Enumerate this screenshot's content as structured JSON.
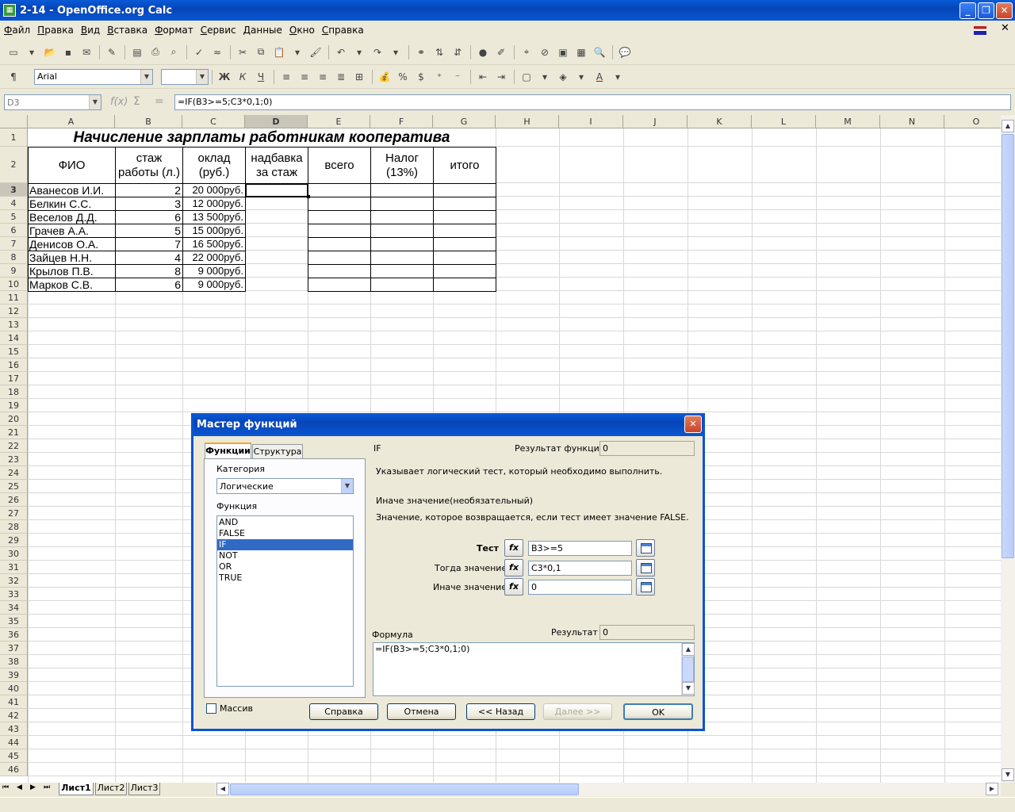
{
  "window": {
    "title": "2-14 - OpenOffice.org Calc"
  },
  "menu": [
    "Файл",
    "Правка",
    "Вид",
    "Вставка",
    "Формат",
    "Сервис",
    "Данные",
    "Окно",
    "Справка"
  ],
  "format_bar": {
    "font_name": "Arial",
    "font_size": ""
  },
  "formula_bar": {
    "name_box": "D3",
    "sum_symbol": "Σ",
    "equals_symbol": "=",
    "formula": "=IF(B3>=5;C3*0,1;0)"
  },
  "columns": [
    "A",
    "B",
    "C",
    "D",
    "E",
    "F",
    "G",
    "H",
    "I",
    "J",
    "K",
    "L",
    "M",
    "N",
    "O"
  ],
  "rows": [
    "1",
    "2",
    "3",
    "4",
    "5",
    "6",
    "7",
    "8",
    "9",
    "10",
    "11",
    "12",
    "13",
    "14",
    "15",
    "16",
    "17",
    "18",
    "19",
    "20",
    "21",
    "22",
    "23",
    "24",
    "25",
    "26",
    "27",
    "28",
    "29",
    "30",
    "31",
    "32",
    "33",
    "34",
    "35",
    "36",
    "37",
    "38",
    "39",
    "40",
    "41",
    "42",
    "43",
    "44",
    "45",
    "46"
  ],
  "sheet": {
    "title": "Начисление зарплаты работникам кооператива",
    "headers": [
      "ФИО",
      "стаж работы (л.)",
      "оклад (руб.)",
      "надбавка за стаж",
      "всего",
      "Налог (13%)",
      "итого"
    ],
    "header_lines": [
      [
        "ФИО"
      ],
      [
        "стаж",
        "работы (л.)"
      ],
      [
        "оклад",
        "(руб.)"
      ],
      [
        "надбавка",
        "за стаж"
      ],
      [
        "всего"
      ],
      [
        "Налог",
        "(13%)"
      ],
      [
        "итого"
      ]
    ],
    "data": [
      {
        "name": "Аванесов И.И.",
        "years": "2",
        "salary": "20 000руб."
      },
      {
        "name": "Белкин С.С.",
        "years": "3",
        "salary": "12 000руб."
      },
      {
        "name": "Веселов Д.Д.",
        "years": "6",
        "salary": "13 500руб."
      },
      {
        "name": "Грачев А.А.",
        "years": "5",
        "salary": "15 000руб."
      },
      {
        "name": "Денисов О.А.",
        "years": "7",
        "salary": "16 500руб."
      },
      {
        "name": "Зайцев Н.Н.",
        "years": "4",
        "salary": "22 000руб."
      },
      {
        "name": "Крылов П.В.",
        "years": "8",
        "salary": "9 000руб."
      },
      {
        "name": "Марков С.В.",
        "years": "6",
        "salary": "9 000руб."
      }
    ]
  },
  "sheet_tabs": [
    "Лист1",
    "Лист2",
    "Лист3"
  ],
  "dialog": {
    "title": "Мастер функций",
    "tabs": [
      "Функции",
      "Структура"
    ],
    "category_label": "Категория",
    "category_value": "Логические",
    "function_label": "Функция",
    "functions": [
      "AND",
      "FALSE",
      "IF",
      "NOT",
      "OR",
      "TRUE"
    ],
    "selected_function": "IF",
    "func_name": "IF",
    "func_result_label": "Результат функции",
    "func_result_value": "0",
    "description": "Указывает логический тест, который необходимо выполнить.",
    "arg_title": "Иначе значение(необязательный)",
    "arg_description": "Значение, которое возвращается, если тест имеет значение FALSE.",
    "args": [
      {
        "label": "Тест",
        "value": "B3>=5"
      },
      {
        "label": "Тогда значение",
        "value": "C3*0,1"
      },
      {
        "label": "Иначе значение",
        "value": "0"
      }
    ],
    "fx_label": "fx",
    "formula_label": "Формула",
    "result_label": "Результат",
    "result_value": "0",
    "formula_text": "=IF(B3>=5;C3*0,1;0)",
    "array_label": "Массив",
    "buttons": {
      "help": "Справка",
      "cancel": "Отмена",
      "back": "<< Назад",
      "next": "Далее >>",
      "ok": "OK"
    }
  }
}
